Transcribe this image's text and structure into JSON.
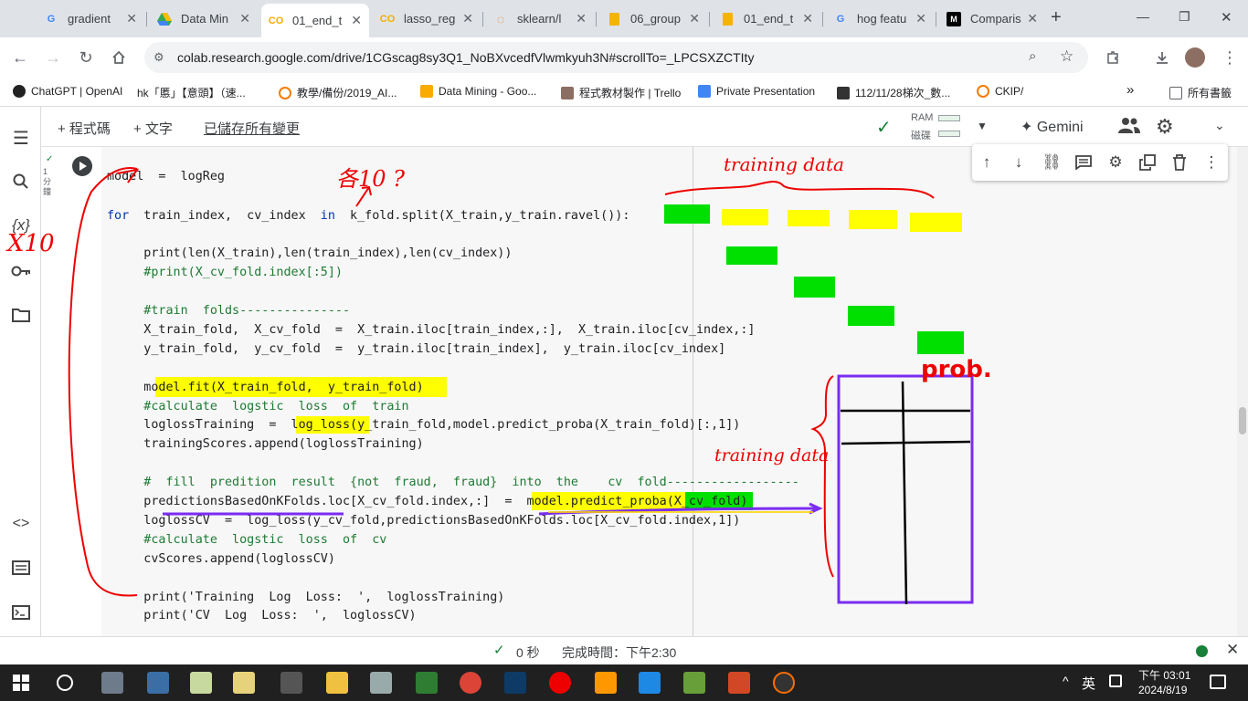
{
  "tabs": [
    {
      "title": "gradient",
      "icon": "google-icon"
    },
    {
      "title": "Data Min",
      "icon": "drive-icon"
    },
    {
      "title": "01_end_t",
      "icon": "colab-icon",
      "active": true
    },
    {
      "title": "lasso_reg",
      "icon": "colab-icon"
    },
    {
      "title": "sklearn/l",
      "icon": "loading-icon"
    },
    {
      "title": "06_group",
      "icon": "slides-icon"
    },
    {
      "title": "01_end_t",
      "icon": "slides-icon"
    },
    {
      "title": "hog featu",
      "icon": "google-icon"
    },
    {
      "title": "Comparis",
      "icon": "medium-icon"
    }
  ],
  "new_tab": "+",
  "window_controls": {
    "minimize": "—",
    "maximize": "❐",
    "close": "✕"
  },
  "address": {
    "url": "colab.research.google.com/drive/1CGscag8sy3Q1_NoBXvcedfVlwmkyuh3N#scrollTo=_LPCSXZCTIty"
  },
  "bookmarks": [
    {
      "label": "ChatGPT | OpenAI",
      "color": "#222"
    },
    {
      "label": "hk「慝」【意頭】（速...",
      "color": "#1a56db"
    },
    {
      "label": "教學/備份/2019_AI...",
      "color": "#f57c00"
    },
    {
      "label": "Data Mining - Goo...",
      "color": "#f9ab00"
    },
    {
      "label": "程式教材製作 | Trello",
      "color": "#8d6e63"
    },
    {
      "label": "Private Presentation",
      "color": "#4285f4"
    },
    {
      "label": "112/11/28梯次_數...",
      "color": "#333"
    },
    {
      "label": "CKIP/",
      "color": "#f57c00"
    }
  ],
  "bookmarks_more": "»",
  "all_bookmarks": "所有書籤",
  "colab": {
    "add_code": "+ 程式碼",
    "add_text": "+ 文字",
    "saved": "已儲存所有變更",
    "ram": "RAM",
    "disk": "磁碟",
    "gemini": "Gemini",
    "exec_time": "1 分鐘"
  },
  "code_lines": [
    "model  =  logReg",
    "",
    "for  train_index,  cv_index  in  k_fold.split(X_train,y_train.ravel()):",
    "",
    "     print(len(X_train),len(train_index),len(cv_index))",
    "     #print(X_cv_fold.index[:5])",
    "",
    "     #train  folds---------------",
    "     X_train_fold,  X_cv_fold  =  X_train.iloc[train_index,:],  X_train.iloc[cv_index,:]",
    "     y_train_fold,  y_cv_fold  =  y_train.iloc[train_index],  y_train.iloc[cv_index]",
    "",
    "     model.fit(X_train_fold,  y_train_fold)",
    "     #calculate  logstic  loss  of  train",
    "     loglossTraining  =  log_loss(y_train_fold,model.predict_proba(X_train_fold)[:,1])",
    "     trainingScores.append(loglossTraining)",
    "",
    "     #  fill  predition  result  {not  fraud,  fraud}  into  the    cv  fold------------------",
    "     predictionsBasedOnKFolds.loc[X_cv_fold.index,:]  =  model.predict_proba(X_cv_fold)",
    "     loglossCV  =  log_loss(y_cv_fold,predictionsBasedOnKFolds.loc[X_cv_fold.index,1])",
    "     #calculate  logstic  loss  of  cv",
    "     cvScores.append(loglossCV)",
    "",
    "     print('Training  Log  Loss:  ',  loglossTraining)",
    "     print('CV  Log  Loss:  ',  loglossCV)"
  ],
  "annotations": {
    "x10_left": "X10",
    "x10_top": "各10 ?",
    "training_data": "training data",
    "prob": "prob.",
    "training_data2": "training data"
  },
  "status": {
    "time": "0 秒",
    "completed": "完成時間：下午2:30"
  },
  "taskbar": {
    "ime": "英",
    "time": "下午 03:01",
    "date": "2024/8/19",
    "tray_arrow": "^"
  }
}
